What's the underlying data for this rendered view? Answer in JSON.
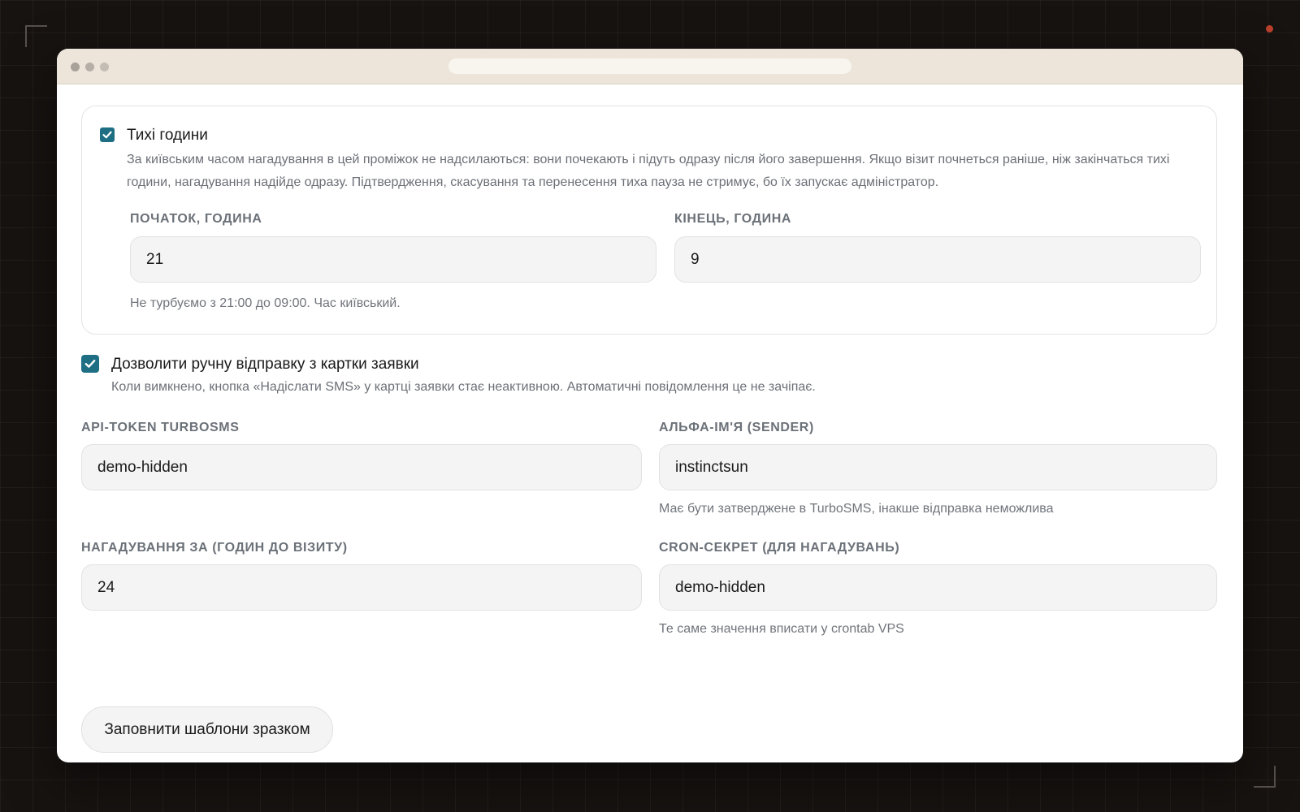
{
  "quiet_hours": {
    "checked": true,
    "title": "Тихі години",
    "description": "За київським часом нагадування в цей проміжок не надсилаються: вони почекають і підуть одразу після його завершення. Якщо візит почнеться раніше, ніж закінчаться тихі години, нагадування надійде одразу. Підтвердження, скасування та перенесення тиха пауза не стримує, бо їх запускає адміністратор.",
    "start_label": "ПОЧАТОК, ГОДИНА",
    "start_value": "21",
    "end_label": "КІНЕЦЬ, ГОДИНА",
    "end_value": "9",
    "summary": "Не турбуємо з 21:00 до 09:00. Час київський."
  },
  "manual_send": {
    "checked": true,
    "title": "Дозволити ручну відправку з картки заявки",
    "description": "Коли вимкнено, кнопка «Надіслати SMS» у картці заявки стає неактивною. Автоматичні повідомлення це не зачіпає."
  },
  "api_token": {
    "label": "API-TOKEN TURBOSMS",
    "value": "demo-hidden"
  },
  "alpha_name": {
    "label": "АЛЬФА-ІМ'Я (SENDER)",
    "value": "instinctsun",
    "hint": "Має бути затверджене в TurboSMS, інакше відправка неможлива"
  },
  "reminder_hours": {
    "label": "НАГАДУВАННЯ ЗА (ГОДИН ДО ВІЗИТУ)",
    "value": "24"
  },
  "cron_secret": {
    "label": "CRON-СЕКРЕТ (ДЛЯ НАГАДУВАНЬ)",
    "value": "demo-hidden",
    "hint": "Те саме значення вписати у crontab VPS"
  },
  "fill_templates_button": "Заповнити шаблони зразком",
  "colors": {
    "accent": "#1e6e84",
    "background": "#171311",
    "titlebar": "#ede5da"
  }
}
